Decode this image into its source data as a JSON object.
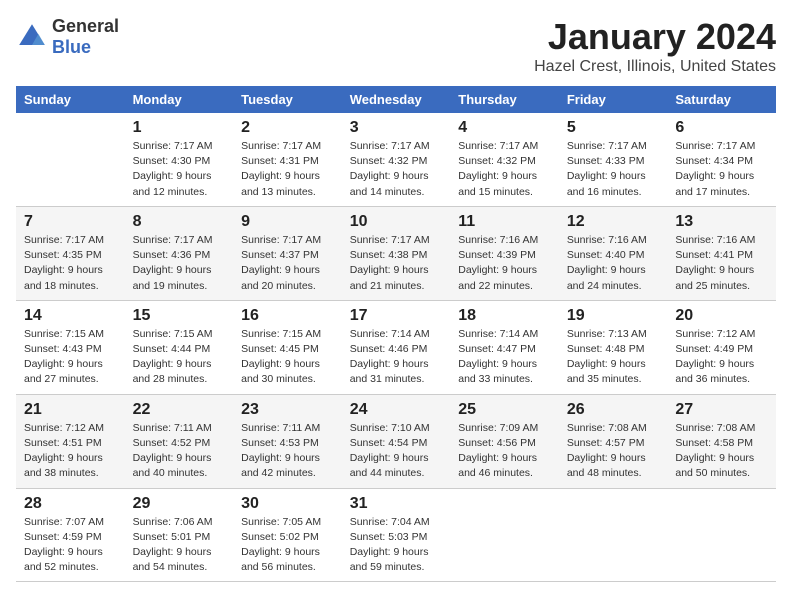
{
  "logo": {
    "general": "General",
    "blue": "Blue"
  },
  "title": "January 2024",
  "subtitle": "Hazel Crest, Illinois, United States",
  "calendar": {
    "headers": [
      "Sunday",
      "Monday",
      "Tuesday",
      "Wednesday",
      "Thursday",
      "Friday",
      "Saturday"
    ],
    "weeks": [
      [
        {
          "day": "",
          "info": ""
        },
        {
          "day": "1",
          "info": "Sunrise: 7:17 AM\nSunset: 4:30 PM\nDaylight: 9 hours\nand 12 minutes."
        },
        {
          "day": "2",
          "info": "Sunrise: 7:17 AM\nSunset: 4:31 PM\nDaylight: 9 hours\nand 13 minutes."
        },
        {
          "day": "3",
          "info": "Sunrise: 7:17 AM\nSunset: 4:32 PM\nDaylight: 9 hours\nand 14 minutes."
        },
        {
          "day": "4",
          "info": "Sunrise: 7:17 AM\nSunset: 4:32 PM\nDaylight: 9 hours\nand 15 minutes."
        },
        {
          "day": "5",
          "info": "Sunrise: 7:17 AM\nSunset: 4:33 PM\nDaylight: 9 hours\nand 16 minutes."
        },
        {
          "day": "6",
          "info": "Sunrise: 7:17 AM\nSunset: 4:34 PM\nDaylight: 9 hours\nand 17 minutes."
        }
      ],
      [
        {
          "day": "7",
          "info": "Sunrise: 7:17 AM\nSunset: 4:35 PM\nDaylight: 9 hours\nand 18 minutes."
        },
        {
          "day": "8",
          "info": "Sunrise: 7:17 AM\nSunset: 4:36 PM\nDaylight: 9 hours\nand 19 minutes."
        },
        {
          "day": "9",
          "info": "Sunrise: 7:17 AM\nSunset: 4:37 PM\nDaylight: 9 hours\nand 20 minutes."
        },
        {
          "day": "10",
          "info": "Sunrise: 7:17 AM\nSunset: 4:38 PM\nDaylight: 9 hours\nand 21 minutes."
        },
        {
          "day": "11",
          "info": "Sunrise: 7:16 AM\nSunset: 4:39 PM\nDaylight: 9 hours\nand 22 minutes."
        },
        {
          "day": "12",
          "info": "Sunrise: 7:16 AM\nSunset: 4:40 PM\nDaylight: 9 hours\nand 24 minutes."
        },
        {
          "day": "13",
          "info": "Sunrise: 7:16 AM\nSunset: 4:41 PM\nDaylight: 9 hours\nand 25 minutes."
        }
      ],
      [
        {
          "day": "14",
          "info": "Sunrise: 7:15 AM\nSunset: 4:43 PM\nDaylight: 9 hours\nand 27 minutes."
        },
        {
          "day": "15",
          "info": "Sunrise: 7:15 AM\nSunset: 4:44 PM\nDaylight: 9 hours\nand 28 minutes."
        },
        {
          "day": "16",
          "info": "Sunrise: 7:15 AM\nSunset: 4:45 PM\nDaylight: 9 hours\nand 30 minutes."
        },
        {
          "day": "17",
          "info": "Sunrise: 7:14 AM\nSunset: 4:46 PM\nDaylight: 9 hours\nand 31 minutes."
        },
        {
          "day": "18",
          "info": "Sunrise: 7:14 AM\nSunset: 4:47 PM\nDaylight: 9 hours\nand 33 minutes."
        },
        {
          "day": "19",
          "info": "Sunrise: 7:13 AM\nSunset: 4:48 PM\nDaylight: 9 hours\nand 35 minutes."
        },
        {
          "day": "20",
          "info": "Sunrise: 7:12 AM\nSunset: 4:49 PM\nDaylight: 9 hours\nand 36 minutes."
        }
      ],
      [
        {
          "day": "21",
          "info": "Sunrise: 7:12 AM\nSunset: 4:51 PM\nDaylight: 9 hours\nand 38 minutes."
        },
        {
          "day": "22",
          "info": "Sunrise: 7:11 AM\nSunset: 4:52 PM\nDaylight: 9 hours\nand 40 minutes."
        },
        {
          "day": "23",
          "info": "Sunrise: 7:11 AM\nSunset: 4:53 PM\nDaylight: 9 hours\nand 42 minutes."
        },
        {
          "day": "24",
          "info": "Sunrise: 7:10 AM\nSunset: 4:54 PM\nDaylight: 9 hours\nand 44 minutes."
        },
        {
          "day": "25",
          "info": "Sunrise: 7:09 AM\nSunset: 4:56 PM\nDaylight: 9 hours\nand 46 minutes."
        },
        {
          "day": "26",
          "info": "Sunrise: 7:08 AM\nSunset: 4:57 PM\nDaylight: 9 hours\nand 48 minutes."
        },
        {
          "day": "27",
          "info": "Sunrise: 7:08 AM\nSunset: 4:58 PM\nDaylight: 9 hours\nand 50 minutes."
        }
      ],
      [
        {
          "day": "28",
          "info": "Sunrise: 7:07 AM\nSunset: 4:59 PM\nDaylight: 9 hours\nand 52 minutes."
        },
        {
          "day": "29",
          "info": "Sunrise: 7:06 AM\nSunset: 5:01 PM\nDaylight: 9 hours\nand 54 minutes."
        },
        {
          "day": "30",
          "info": "Sunrise: 7:05 AM\nSunset: 5:02 PM\nDaylight: 9 hours\nand 56 minutes."
        },
        {
          "day": "31",
          "info": "Sunrise: 7:04 AM\nSunset: 5:03 PM\nDaylight: 9 hours\nand 59 minutes."
        },
        {
          "day": "",
          "info": ""
        },
        {
          "day": "",
          "info": ""
        },
        {
          "day": "",
          "info": ""
        }
      ]
    ]
  }
}
